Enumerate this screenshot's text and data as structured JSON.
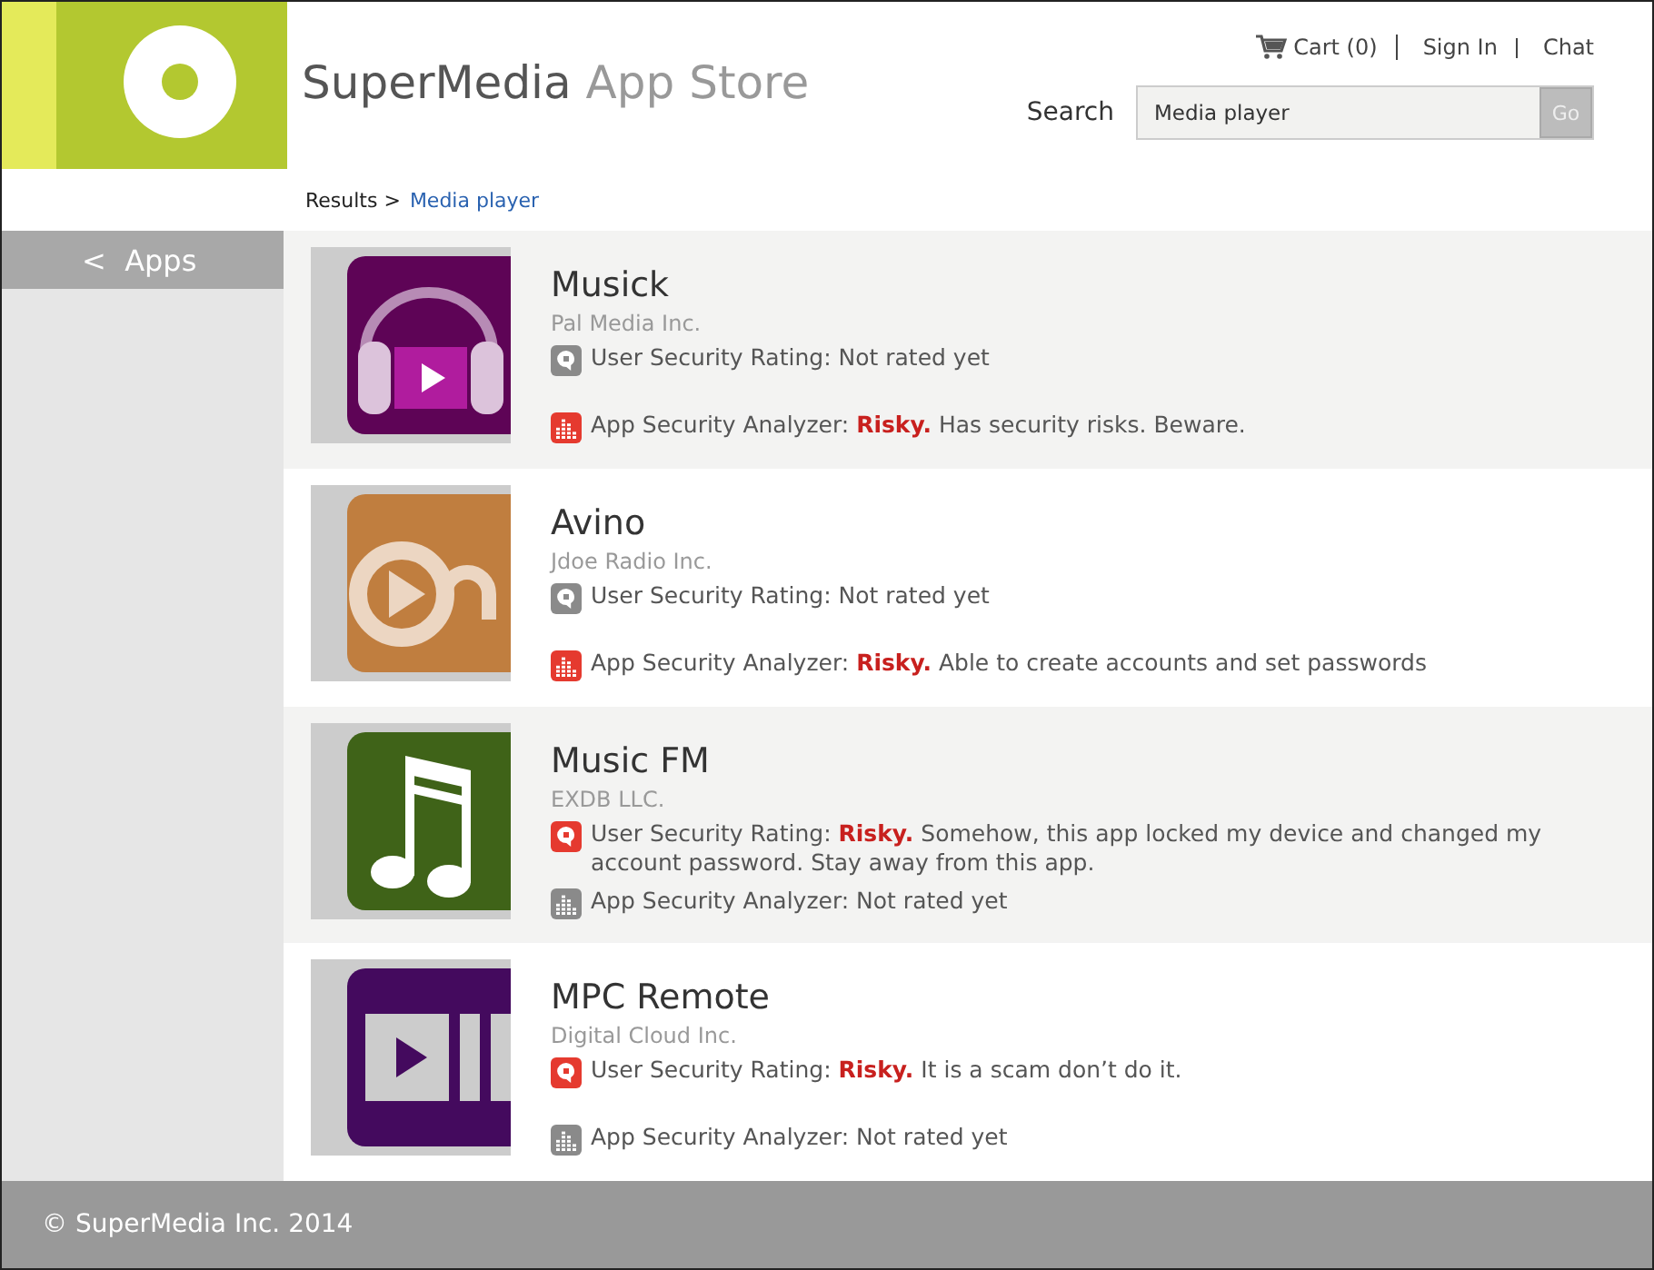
{
  "header": {
    "brand": "SuperMedia",
    "brand_suffix": "App Store",
    "links": [
      {
        "label": "Cart (0)",
        "kind": "cart"
      },
      {
        "label": "Sign In",
        "kind": "plain"
      },
      {
        "label": "Chat",
        "kind": "plain"
      }
    ],
    "search": {
      "label": "Search",
      "value": "Media player",
      "button": "Go"
    }
  },
  "breadcrumb": {
    "prefix": "Results >",
    "current": "Media player"
  },
  "sidebar": {
    "items": [
      {
        "label": "<  Apps",
        "selected": true
      }
    ]
  },
  "apps": [
    {
      "name": "Musick",
      "publisher": "Pal Media Inc.",
      "kind": "headphones",
      "user_rating": {
        "risky": false,
        "text": "User Security Rating: Not rated yet"
      },
      "analyzer": {
        "risky": true,
        "text": "App Security Analyzer: **Risky.** Has security risks. Beware."
      }
    },
    {
      "name": "Avino",
      "publisher": "Jdoe Radio Inc.",
      "kind": "swirl",
      "user_rating": {
        "risky": false,
        "text": "User Security Rating: Not rated yet"
      },
      "analyzer": {
        "risky": true,
        "text": "App Security Analyzer: **Risky.** Able to create accounts and set passwords"
      }
    },
    {
      "name": "Music FM",
      "publisher": "EXDB LLC.",
      "kind": "note",
      "user_rating": {
        "risky": true,
        "text": "User Security Rating: **Risky.** Somehow, this app locked my device and changed my account password. Stay away from this app."
      },
      "analyzer": {
        "risky": false,
        "text": "App Security Analyzer: Not rated yet"
      }
    },
    {
      "name": "MPC Remote",
      "publisher": "Digital Cloud Inc.",
      "kind": "video",
      "user_rating": {
        "risky": true,
        "text": "User Security Rating: **Risky.** It is a scam don’t do it."
      },
      "analyzer": {
        "risky": false,
        "text": "App Security Analyzer: Not rated yet"
      }
    }
  ],
  "footer": {
    "text": "© SuperMedia Inc. 2014"
  }
}
